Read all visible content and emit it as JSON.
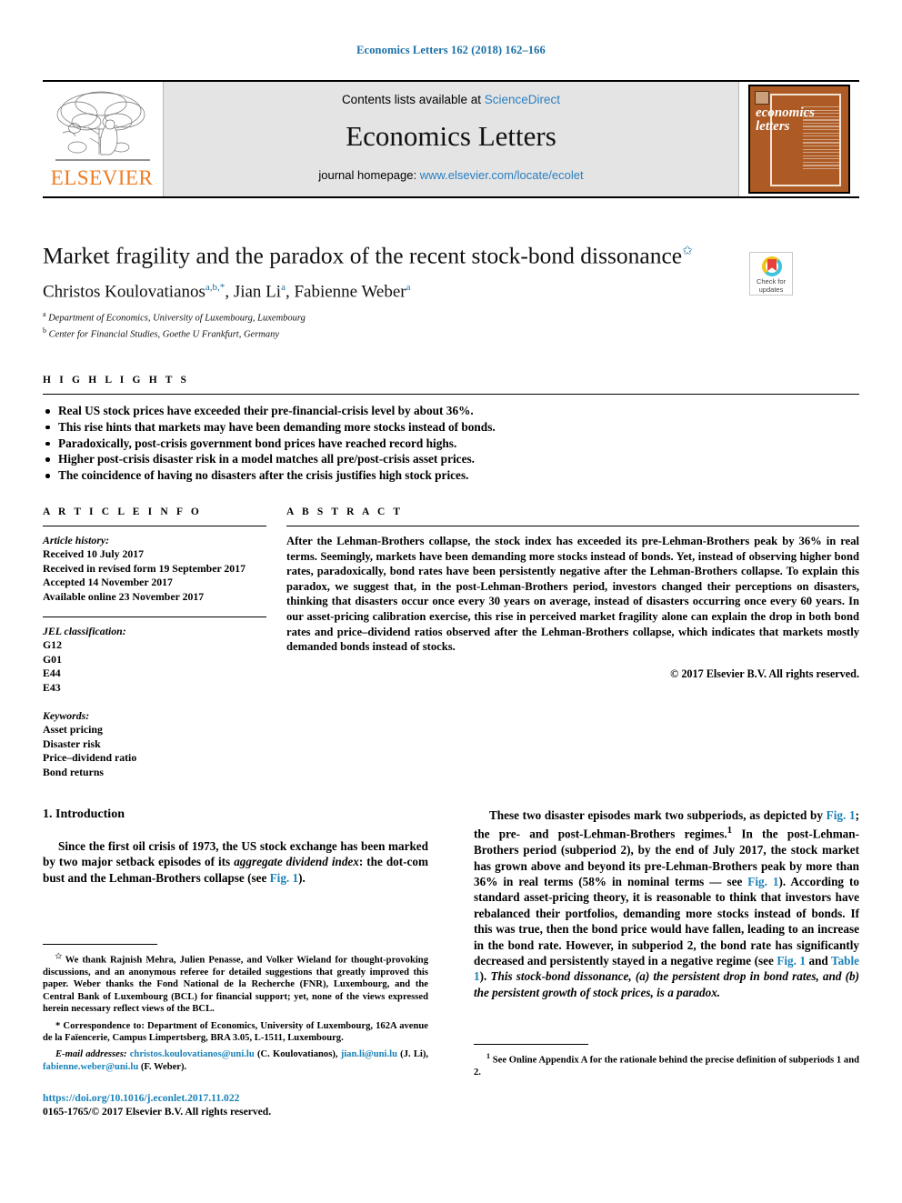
{
  "running_head": "Economics Letters 162 (2018) 162–166",
  "masthead": {
    "contents_prefix": "Contents lists available at ",
    "contents_link": "ScienceDirect",
    "journal_title": "Economics Letters",
    "homepage_prefix": "journal homepage: ",
    "homepage_link": "www.elsevier.com/locate/ecolet",
    "publisher_logo_text": "ELSEVIER",
    "cover_journal_name": "economics letters"
  },
  "crossmark": {
    "line1": "Check for",
    "line2": "updates"
  },
  "article": {
    "title": "Market fragility and the paradox of the recent stock-bond dissonance",
    "title_marker": "✩",
    "authors": "Christos Koulovatianos, Jian Li, Fabienne Weber",
    "author_list": [
      {
        "name": "Christos Koulovatianos",
        "marks": "a,b,*"
      },
      {
        "name": "Jian Li",
        "marks": "a"
      },
      {
        "name": "Fabienne Weber",
        "marks": "a"
      }
    ],
    "affiliations": [
      {
        "mark": "a",
        "text": "Department of Economics, University of Luxembourg, Luxembourg"
      },
      {
        "mark": "b",
        "text": "Center for Financial Studies, Goethe U Frankfurt, Germany"
      }
    ]
  },
  "highlights": {
    "label": "H I G H L I G H T S",
    "items": [
      "Real US stock prices have exceeded their pre-financial-crisis level by about 36%.",
      "This rise hints that markets may have been demanding more stocks instead of bonds.",
      "Paradoxically, post-crisis government bond prices have reached record highs.",
      "Higher post-crisis disaster risk in a model matches all pre/post-crisis asset prices.",
      "The coincidence of having no disasters after the crisis justifies high stock prices."
    ]
  },
  "article_info": {
    "label": "A R T I C L E    I N F O",
    "history_heading": "Article history:",
    "history": [
      "Received 10 July 2017",
      "Received in revised form 19 September 2017",
      "Accepted 14 November 2017",
      "Available online 23 November 2017"
    ],
    "jel_heading": "JEL classification:",
    "jel_codes": [
      "G12",
      "G01",
      "E44",
      "E43"
    ],
    "keywords_heading": "Keywords:",
    "keywords": [
      "Asset pricing",
      "Disaster risk",
      "Price–dividend ratio",
      "Bond returns"
    ]
  },
  "abstract": {
    "label": "A B S T R A C T",
    "text": "After the Lehman-Brothers collapse, the stock index has exceeded its pre-Lehman-Brothers peak by 36% in real terms. Seemingly, markets have been demanding more stocks instead of bonds. Yet, instead of observing higher bond rates, paradoxically, bond rates have been persistently negative after the Lehman-Brothers collapse. To explain this paradox, we suggest that, in the post-Lehman-Brothers period, investors changed their perceptions on disasters, thinking that disasters occur once every 30 years on average, instead of disasters occurring once every 60 years. In our asset-pricing calibration exercise, this rise in perceived market fragility alone can explain the drop in both bond rates and price–dividend ratios observed after the Lehman-Brothers collapse, which indicates that markets mostly demanded bonds instead of stocks.",
    "copyright": "© 2017 Elsevier B.V. All rights reserved."
  },
  "introduction": {
    "heading": "1. Introduction",
    "left_p1_a": "Since the first oil crisis of 1973, the US stock exchange has been marked by two major setback episodes of its ",
    "left_p1_italic": "aggregate dividend index",
    "left_p1_b": ": the dot-com bust and the Lehman-Brothers collapse (see ",
    "left_p1_link": "Fig. 1",
    "left_p1_c": ").",
    "right_p1_a": "These two disaster episodes mark two subperiods, as depicted by ",
    "right_link1": "Fig. 1",
    "right_p1_b": "; the pre- and post-Lehman-Brothers regimes.",
    "right_fn_marker": "1",
    "right_p1_c": " In the post-Lehman-Brothers period (subperiod 2), by the end of July 2017, the stock market has grown above and beyond its pre-Lehman-Brothers peak by more than 36% in real terms (58% in nominal terms — see ",
    "right_link2": "Fig. 1",
    "right_p1_d": "). According to standard asset-pricing theory, it is reasonable to think that investors have rebalanced their portfolios, demanding more stocks instead of bonds. If this was true, then the bond price would have fallen, leading to an increase in the bond rate. However, in subperiod 2, the bond rate has significantly decreased and persistently stayed in a negative regime (see ",
    "right_link3": "Fig. 1",
    "right_p1_e": " and ",
    "right_link4": "Table 1",
    "right_p1_f": "). ",
    "right_p1_italic": "This stock-bond dissonance, (a) the persistent drop in bond rates, and (b) the persistent growth of stock prices, is a paradox."
  },
  "footnotes": {
    "star_marker": "✩",
    "star_text": "We thank Rajnish Mehra, Julien Penasse, and Volker Wieland for thought-provoking discussions, and an anonymous referee for detailed suggestions that greatly improved this paper. Weber thanks the Fond National de la Recherche (FNR), Luxembourg, and the Central Bank of Luxembourg (BCL) for financial support; yet, none of the views expressed herein necessary reflect views of the BCL.",
    "corr_marker": "*",
    "corr_text": "Correspondence to: Department of Economics, University of Luxembourg, 162A avenue de la Faïencerie, Campus Limpertsberg, BRA 3.05, L-1511, Luxembourg.",
    "email_heading": "E-mail addresses:",
    "emails": [
      {
        "address": "christos.koulovatianos@uni.lu",
        "owner": "(C. Koulovatianos),"
      },
      {
        "address": "jian.li@uni.lu",
        "owner": "(J. Li),"
      },
      {
        "address": "fabienne.weber@uni.lu",
        "owner": "(F. Weber)."
      }
    ],
    "right_marker": "1",
    "right_text": "See Online Appendix A for the rationale behind the precise definition of subperiods 1 and 2."
  },
  "footer": {
    "doi": "https://doi.org/10.1016/j.econlet.2017.11.022",
    "issn": "0165-1765/© 2017 Elsevier B.V. All rights reserved."
  },
  "colors": {
    "link_blue": "#1a82b8",
    "header_blue": "#1a6fa5",
    "elsevier_orange": "#ef7c22",
    "cover_brown": "#ad5a24",
    "masthead_gray": "#e4e4e4"
  }
}
